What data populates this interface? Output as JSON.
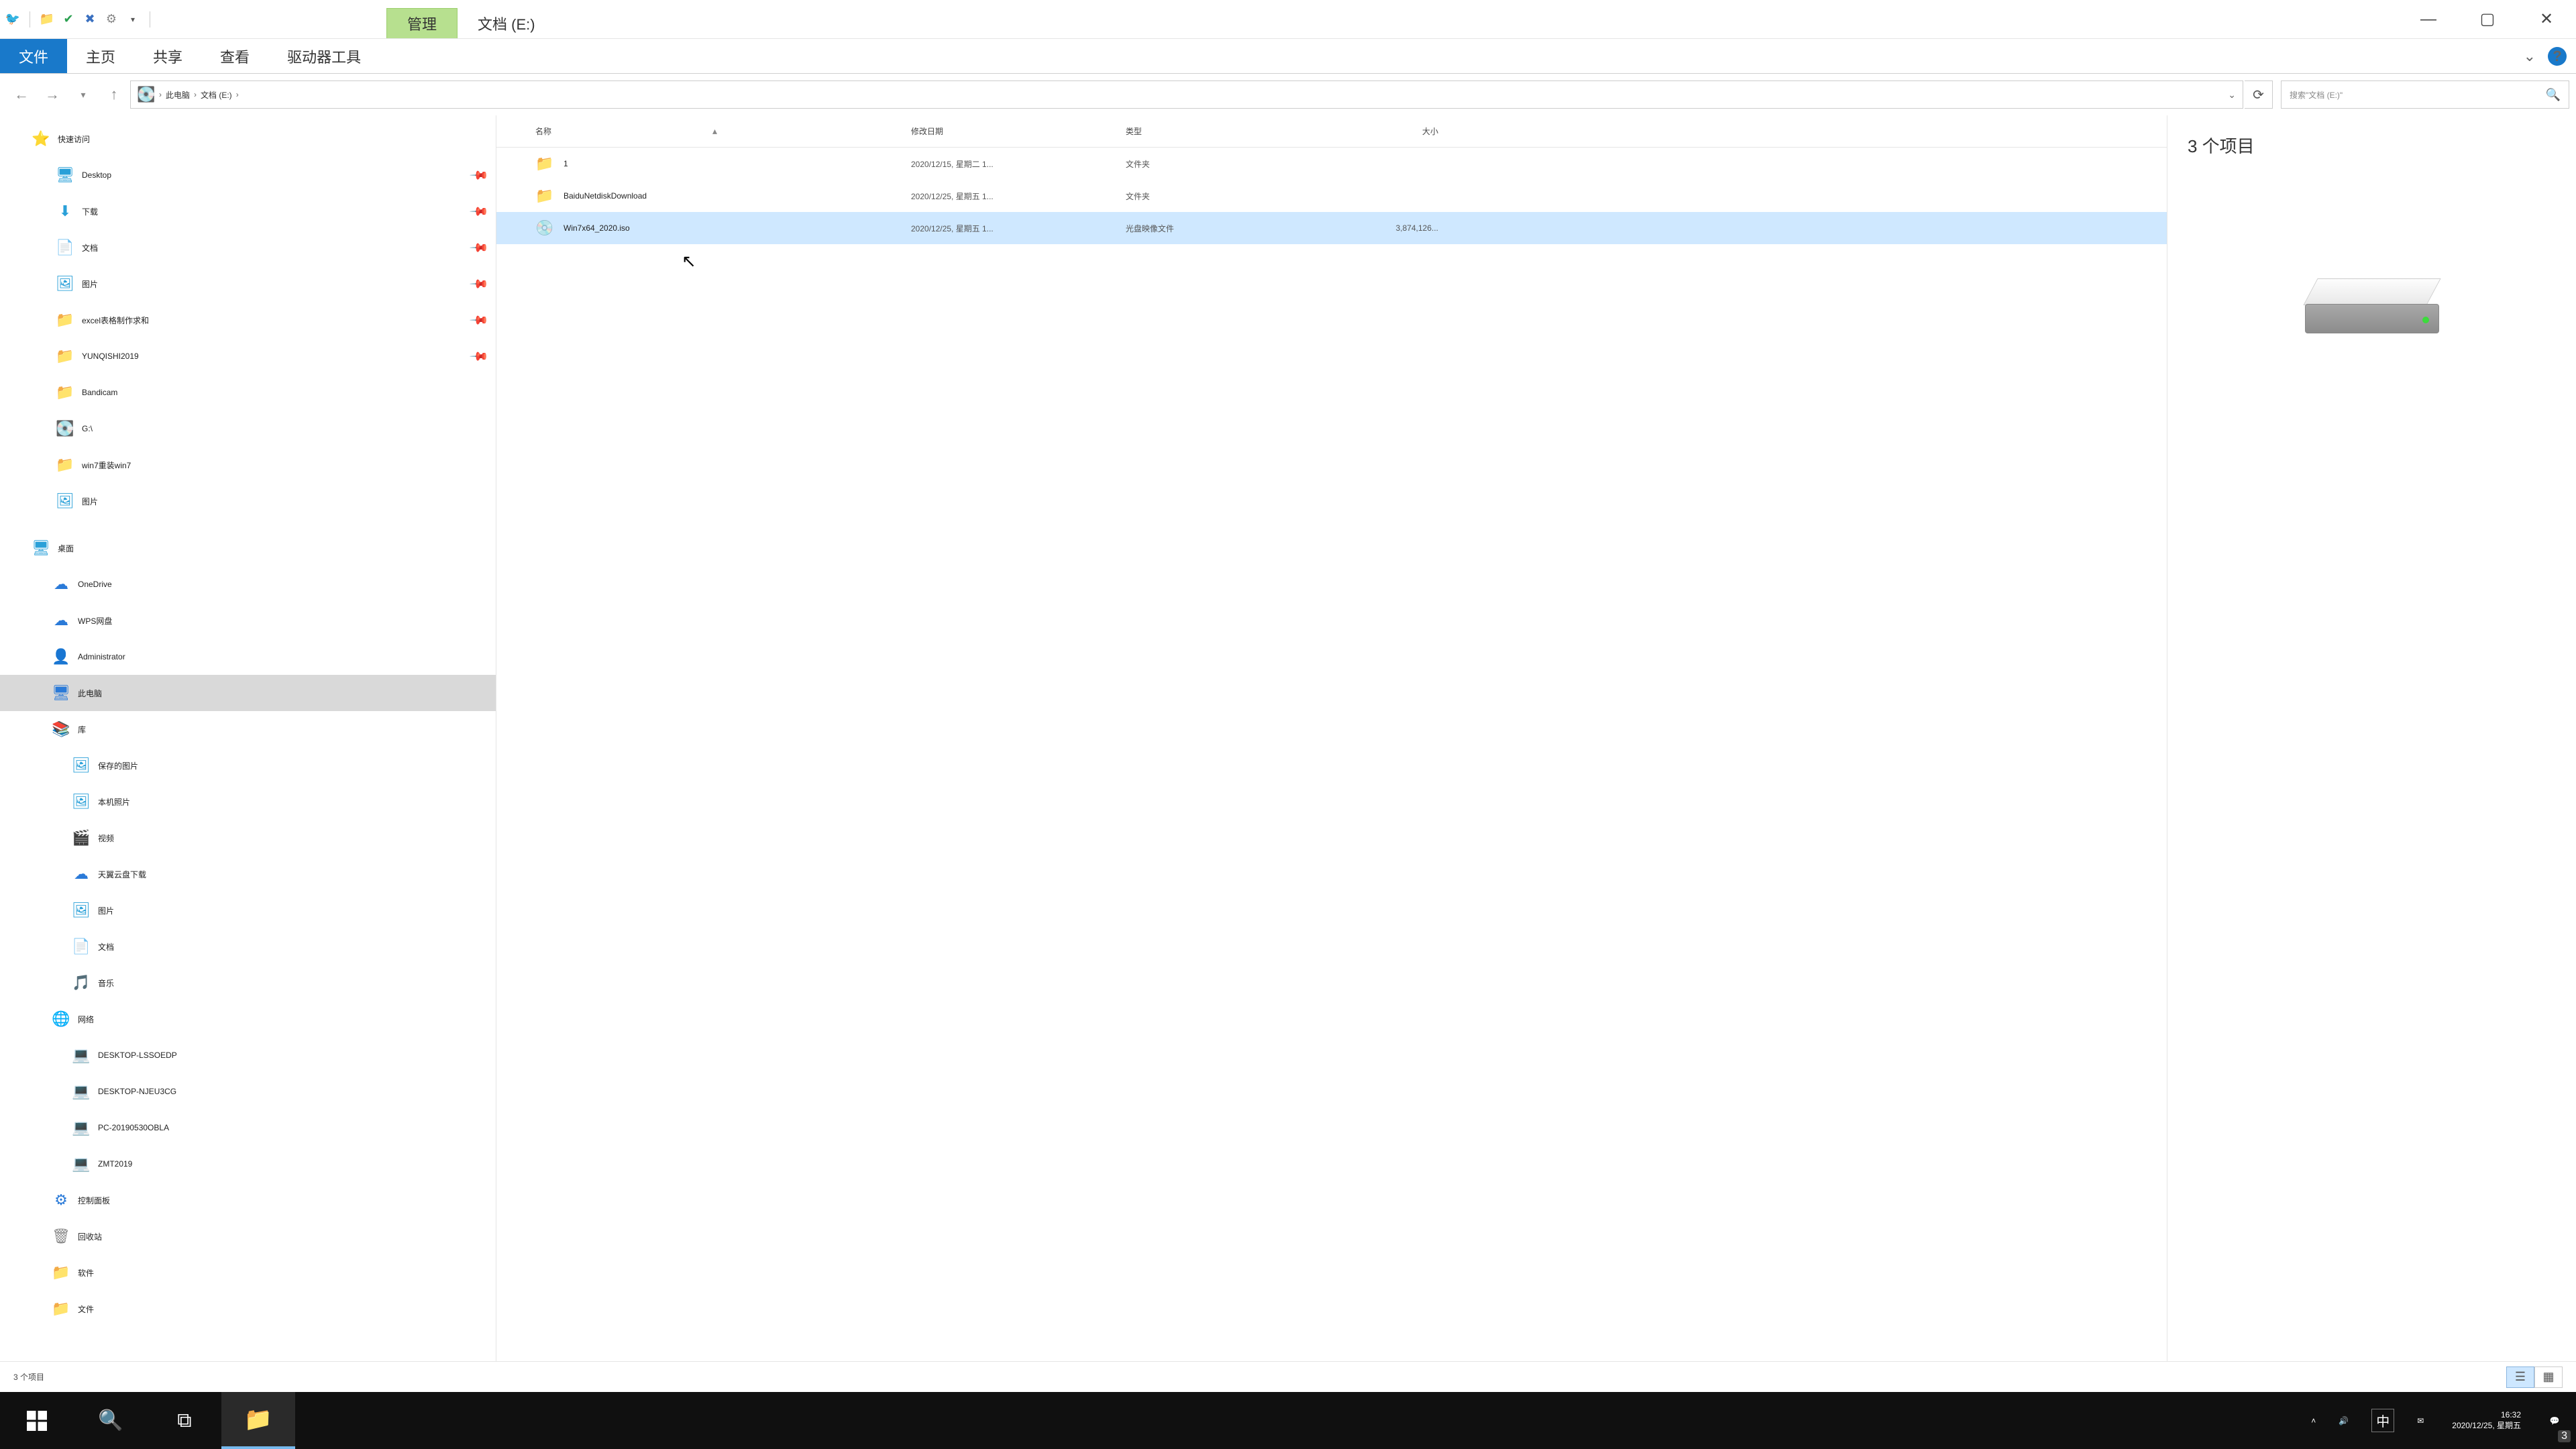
{
  "title_context_tab": "管理",
  "title_location": "文档 (E:)",
  "window_controls": {
    "min": "—",
    "max": "▢",
    "close": "✕"
  },
  "ribbon_tabs": {
    "file": "文件",
    "home": "主页",
    "share": "共享",
    "view": "查看",
    "drives": "驱动器工具"
  },
  "nav": {
    "back": "←",
    "forward": "→",
    "up": "↑"
  },
  "breadcrumbs": [
    "此电脑",
    "文档 (E:)"
  ],
  "search_placeholder": "搜索\"文档 (E:)\"",
  "columns": {
    "name": "名称",
    "date": "修改日期",
    "type": "类型",
    "size": "大小"
  },
  "files": [
    {
      "name": "1",
      "date": "2020/12/15, 星期二 1...",
      "type": "文件夹",
      "size": "",
      "icon": "folder"
    },
    {
      "name": "BaiduNetdiskDownload",
      "date": "2020/12/25, 星期五 1...",
      "type": "文件夹",
      "size": "",
      "icon": "folder"
    },
    {
      "name": "Win7x64_2020.iso",
      "date": "2020/12/25, 星期五 1...",
      "type": "光盘映像文件",
      "size": "3,874,126...",
      "icon": "iso"
    }
  ],
  "sidebar": {
    "quick": "快速访问",
    "quick_items": [
      {
        "label": "Desktop",
        "icon": "desk",
        "pin": true
      },
      {
        "label": "下载",
        "icon": "down",
        "pin": true
      },
      {
        "label": "文档",
        "icon": "doc",
        "pin": true
      },
      {
        "label": "图片",
        "icon": "pic",
        "pin": true
      },
      {
        "label": "excel表格制作求和",
        "icon": "folder",
        "pin": true
      },
      {
        "label": "YUNQISHI2019",
        "icon": "folder",
        "pin": true
      },
      {
        "label": "Bandicam",
        "icon": "folder"
      },
      {
        "label": "G:\\",
        "icon": "drv"
      },
      {
        "label": "win7重装win7",
        "icon": "folder"
      },
      {
        "label": "图片",
        "icon": "pic"
      }
    ],
    "desktop": "桌面",
    "desktop_items": [
      {
        "label": "OneDrive",
        "icon": "cloud"
      },
      {
        "label": "WPS网盘",
        "icon": "cloud"
      },
      {
        "label": "Administrator",
        "icon": "user"
      },
      {
        "label": "此电脑",
        "icon": "pc",
        "selected": true
      },
      {
        "label": "库",
        "icon": "lib"
      }
    ],
    "lib_items": [
      {
        "label": "保存的图片",
        "icon": "pic"
      },
      {
        "label": "本机照片",
        "icon": "pic"
      },
      {
        "label": "视频",
        "icon": "vid"
      },
      {
        "label": "天翼云盘下载",
        "icon": "cloud"
      },
      {
        "label": "图片",
        "icon": "pic"
      },
      {
        "label": "文档",
        "icon": "doc"
      },
      {
        "label": "音乐",
        "icon": "music"
      }
    ],
    "network": "网络",
    "net_items": [
      {
        "label": "DESKTOP-LSSOEDP",
        "icon": "comp"
      },
      {
        "label": "DESKTOP-NJEU3CG",
        "icon": "comp"
      },
      {
        "label": "PC-20190530OBLA",
        "icon": "comp"
      },
      {
        "label": "ZMT2019",
        "icon": "comp"
      }
    ],
    "tail": [
      {
        "label": "控制面板",
        "icon": "cp"
      },
      {
        "label": "回收站",
        "icon": "bin"
      },
      {
        "label": "软件",
        "icon": "folder"
      },
      {
        "label": "文件",
        "icon": "folder"
      }
    ]
  },
  "preview_count": "3 个项目",
  "status_text": "3 个项目",
  "taskbar": {
    "time": "16:32",
    "date": "2020/12/25, 星期五",
    "ime": "中",
    "notif_count": "3"
  }
}
